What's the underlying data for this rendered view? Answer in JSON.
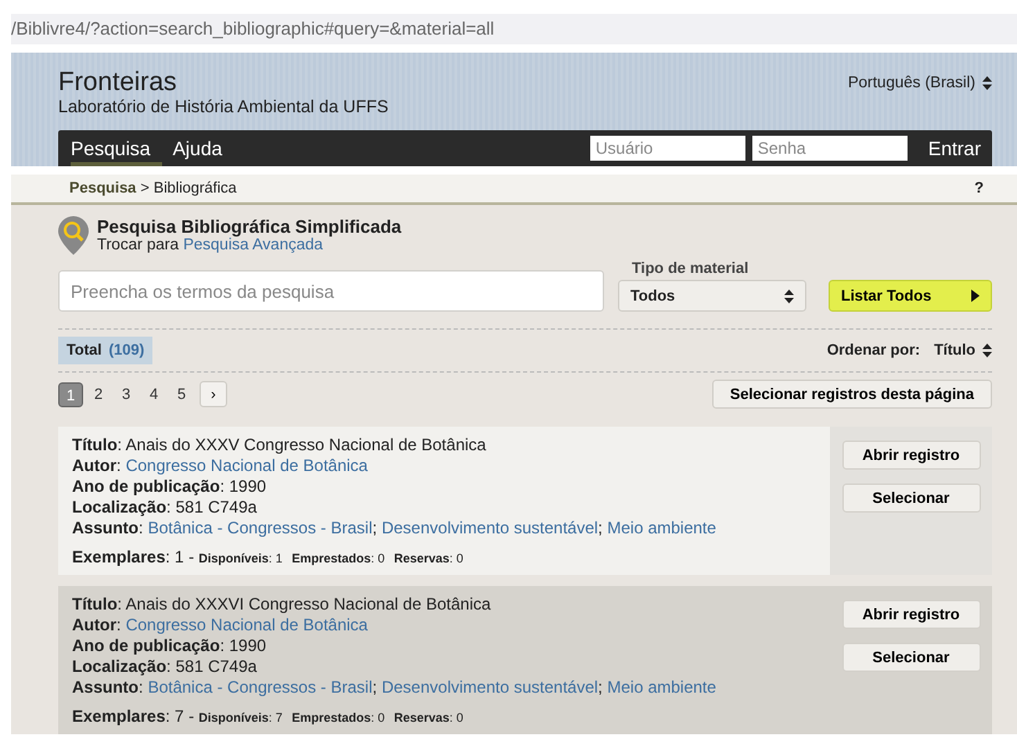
{
  "address_bar": {
    "url": "/Biblivre4/?action=search_bibliographic#query=&material=all"
  },
  "header": {
    "title": "Fronteiras",
    "subtitle": "Laboratório de História Ambiental da UFFS",
    "language": "Português (Brasil)"
  },
  "nav": {
    "tabs": [
      {
        "label": "Pesquisa",
        "selected": true
      },
      {
        "label": "Ajuda",
        "selected": false
      }
    ],
    "username": {
      "placeholder": "Usuário"
    },
    "password": {
      "placeholder": "Senha"
    },
    "login_button": "Entrar"
  },
  "breadcrumb": {
    "current_section": "Pesquisa",
    "separator": ">",
    "page": "Bibliográfica",
    "help": "?"
  },
  "search": {
    "title": "Pesquisa Bibliográfica Simplificada",
    "switch_prefix": "Trocar para",
    "switch_link": "Pesquisa Avançada",
    "query": {
      "placeholder": "Preencha os termos da pesquisa"
    },
    "material_label": "Tipo de material",
    "material_value": "Todos",
    "list_all_button": "Listar Todos"
  },
  "results": {
    "total_label": "Total",
    "total_count": "(109)",
    "sort_label": "Ordenar por:",
    "sort_value": "Título",
    "pages": [
      {
        "label": "1",
        "selected": true
      },
      {
        "label": "2",
        "selected": false
      },
      {
        "label": "3",
        "selected": false
      },
      {
        "label": "4",
        "selected": false
      },
      {
        "label": "5",
        "selected": false
      }
    ],
    "next_page": "›",
    "select_page_button": "Selecionar registros desta página",
    "records": [
      {
        "fields": [
          {
            "label": "**Título**:",
            "value": "Anais do XXXV Congresso Nacional de Botânica",
            "kind": "text"
          },
          {
            "label": "**Autor**:",
            "value": "Congresso Nacional de Botânica",
            "kind": "link"
          },
          {
            "label": "**Ano de publicação**:",
            "value": "1990",
            "kind": "text"
          },
          {
            "label": "**Localização**:",
            "value": "581 C749a",
            "kind": "text"
          }
        ],
        "subject_label": "**Assunto**:",
        "subject_separator": ";",
        "subjects": [
          "Botânica - Congressos - Brasil",
          "Desenvolvimento sustentável",
          "Meio ambiente"
        ],
        "copies": {
          "summary": "**Exemplares**: 1 -",
          "details": [
            "**Disponíveis**: 1",
            "**Emprestados**: 0",
            "**Reservas**: 0"
          ]
        },
        "buttons": [
          "Abrir registro",
          "Selecionar"
        ]
      },
      {
        "fields": [
          {
            "label": "**Título**:",
            "value": "Anais do XXXVI Congresso Nacional de Botânica",
            "kind": "text"
          },
          {
            "label": "**Autor**:",
            "value": "Congresso Nacional de Botânica",
            "kind": "link"
          },
          {
            "label": "**Ano de publicação**:",
            "value": "1990",
            "kind": "text"
          },
          {
            "label": "**Localização**:",
            "value": "581 C749a",
            "kind": "text"
          }
        ],
        "subject_label": "**Assunto**:",
        "subject_separator": ";",
        "subjects": [
          "Botânica - Congressos - Brasil",
          "Desenvolvimento sustentável",
          "Meio ambiente"
        ],
        "copies": {
          "summary": "**Exemplares**: 7 -",
          "details": [
            "**Disponíveis**: 7",
            "**Emprestados**: 0",
            "**Reservas**: 0"
          ]
        },
        "buttons": [
          "Abrir registro",
          "Selecionar"
        ]
      }
    ]
  }
}
